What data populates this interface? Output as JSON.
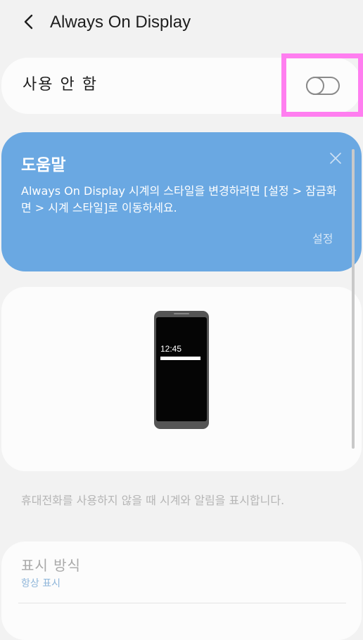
{
  "header": {
    "title": "Always On Display",
    "back_icon": "chevron-left-icon"
  },
  "master_toggle": {
    "label": "사용 안 함",
    "state": "off"
  },
  "help": {
    "title": "도움말",
    "body": "Always On Display 시계의 스타일을 변경하려면 [설정 > 잠금화면 > 시계 스타일]로 이동하세요.",
    "action_label": "설정",
    "close_icon": "close-icon",
    "background_color": "#6aa8e2"
  },
  "preview": {
    "time": "12:45"
  },
  "description": "휴대전화를 사용하지 않을 때 시계와 알림을 표시합니다.",
  "display_mode": {
    "title": "표시 방식",
    "value": "항상 표시"
  },
  "highlight_color": "#ff7ef0"
}
